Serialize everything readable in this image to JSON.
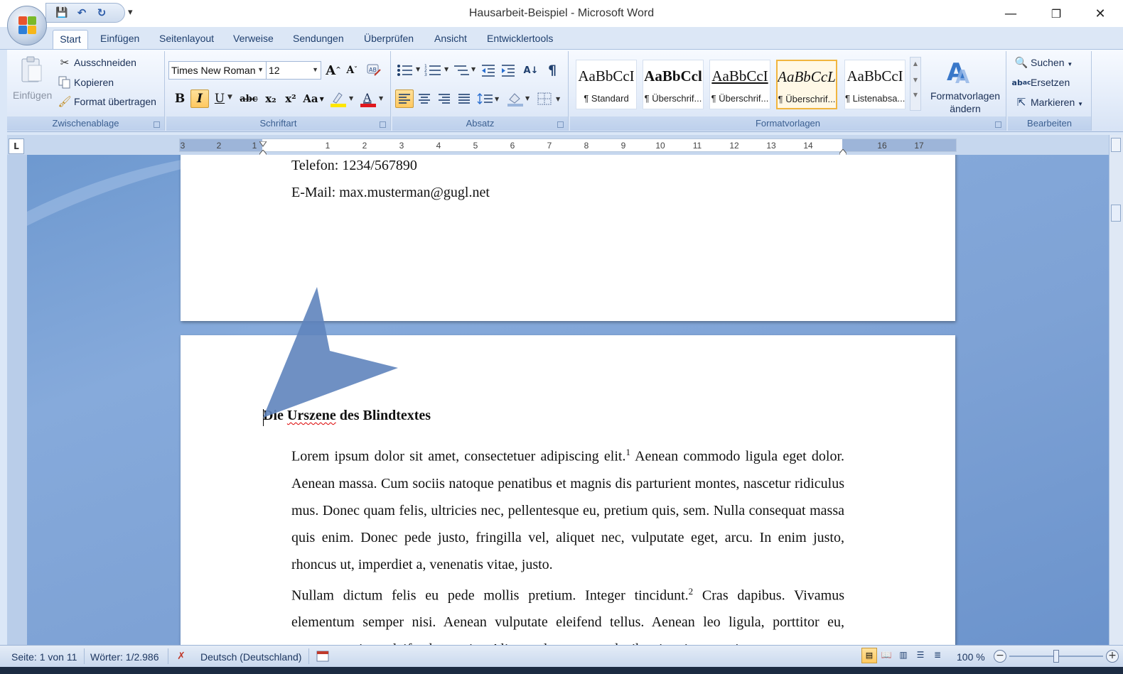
{
  "window": {
    "title": "Hausarbeit-Beispiel - Microsoft Word",
    "minimize": "—",
    "restore": "❐",
    "close": "✕"
  },
  "qat": {
    "save": "💾",
    "undo": "↶",
    "redo": "↻",
    "more": "▾"
  },
  "tabs": [
    "Start",
    "Einfügen",
    "Seitenlayout",
    "Verweise",
    "Sendungen",
    "Überprüfen",
    "Ansicht",
    "Entwicklertools"
  ],
  "ribbon": {
    "clipboard": {
      "label": "Zwischenablage",
      "paste": "Einfügen",
      "cut": "Ausschneiden",
      "copy": "Kopieren",
      "format_painter": "Format übertragen"
    },
    "font": {
      "label": "Schriftart",
      "font_name": "Times New Roman",
      "font_size": "12",
      "bold": "B",
      "italic": "I",
      "underline": "U",
      "strike": "abc",
      "subscript": "x₂",
      "superscript": "x²",
      "case": "Aa",
      "grow": "A",
      "shrink": "A",
      "highlight": "ab",
      "font_color": "A"
    },
    "paragraph": {
      "label": "Absatz"
    },
    "styles": {
      "label": "Formatvorlagen",
      "items": [
        {
          "sample": "AaBbCcI",
          "name": "¶ Standard"
        },
        {
          "sample": "AaBbCcl",
          "name": "¶ Überschrif..."
        },
        {
          "sample": "AaBbCcI",
          "name": "¶ Überschrif..."
        },
        {
          "sample": "AaBbCcL",
          "name": "¶ Überschrif..."
        },
        {
          "sample": "AaBbCcI",
          "name": "¶ Listenabsa..."
        }
      ],
      "change_styles": "Formatvorlagen ändern"
    },
    "editing": {
      "label": "Bearbeiten",
      "find": "Suchen",
      "replace": "Ersetzen",
      "select": "Markieren"
    }
  },
  "ruler": {
    "tab_selector": "L",
    "left_numbers": [
      "3",
      "2",
      "1"
    ],
    "numbers": [
      "1",
      "2",
      "3",
      "4",
      "5",
      "6",
      "7",
      "8",
      "9",
      "10",
      "11",
      "12",
      "13",
      "14",
      "16",
      "17"
    ]
  },
  "document": {
    "page1_lines": [
      "Telefon: 1234/567890",
      "E-Mail: max.musterman@gugl.net"
    ],
    "heading_prefix": "Die ",
    "heading_word": "Urszene",
    "heading_suffix": " des Blindtextes",
    "para1": "Lorem ipsum dolor sit amet, consectetuer adipiscing elit.",
    "fn1": "1",
    "para1b": " Aenean commodo ligula eget dolor. Aenean massa. Cum sociis natoque penatibus et magnis dis parturient montes, nascetur ridiculus mus. Donec quam felis, ultricies nec, pellentesque eu, pretium quis, sem. Nulla consequat massa quis enim. Donec pede justo, fringilla vel, aliquet nec, vulputate eget, arcu. In enim justo, rhoncus ut, imperdiet a, venenatis vitae, justo.",
    "para2": "Nullam dictum felis eu pede mollis pretium. Integer tincidunt.",
    "fn2": "2",
    "para2b": " Cras dapibus. Vivamus elementum semper nisi. Aenean vulputate eleifend tellus. Aenean leo ligula, porttitor eu, consequat vitae, eleifend ac, enim. Aliquam lorem ante, dapibus in, viverra quis,"
  },
  "status": {
    "page": "Seite: 1 von 11",
    "words": "Wörter: 1/2.986",
    "language": "Deutsch (Deutschland)",
    "zoom": "100 %"
  }
}
